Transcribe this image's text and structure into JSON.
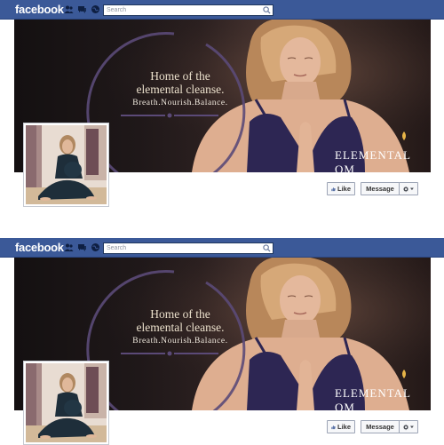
{
  "screens": [
    {
      "header": {
        "logo": "facebook",
        "search_placeholder": "Search"
      },
      "cover": {
        "headline_line1": "Home of the",
        "headline_line2": "elemental cleanse.",
        "tagline": "Breath.Nourish.Balance.",
        "brand": "ELEMENTAL OM"
      },
      "actions": {
        "like": "Like",
        "message": "Message"
      }
    },
    {
      "header": {
        "logo": "facebook",
        "search_placeholder": "Search"
      },
      "cover": {
        "headline_line1": "Home of the",
        "headline_line2": "elemental cleanse.",
        "tagline": "Breath.Nourish.Balance.",
        "brand": "ELEMENTAL OM"
      },
      "actions": {
        "like": "Like",
        "message": "Message"
      }
    }
  ],
  "icons": [
    "friend-requests-icon",
    "messages-icon",
    "notifications-globe-icon",
    "search-icon",
    "thumbs-up-icon",
    "gear-icon",
    "chevron-down-icon"
  ],
  "colors": {
    "facebook_blue": "#3b5998",
    "cover_text": "#eadfcb",
    "arc_purple": "#5b4a78",
    "bra_purple": "#2d2653"
  }
}
